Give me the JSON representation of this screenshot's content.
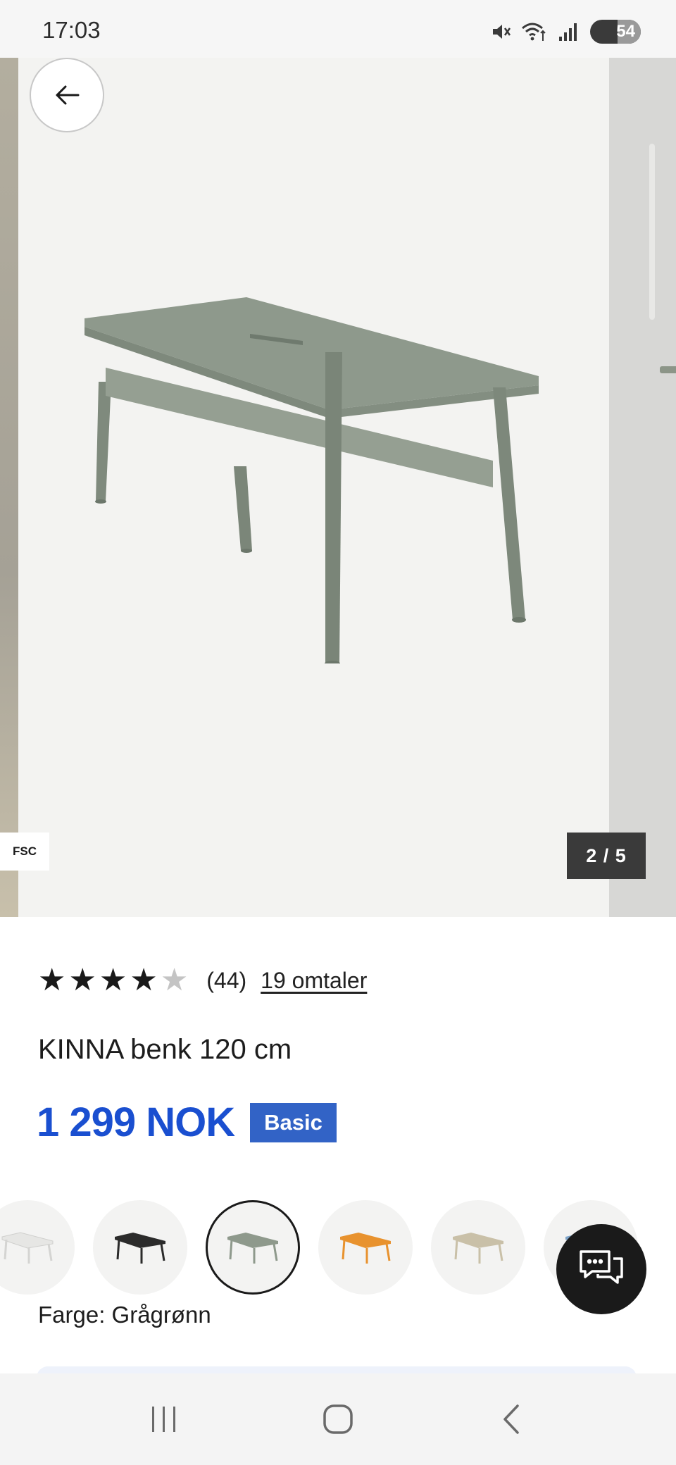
{
  "status_bar": {
    "time": "17:03",
    "battery": "54",
    "icons": [
      "mute-icon",
      "wifi-icon",
      "signal-icon",
      "battery-icon"
    ]
  },
  "gallery": {
    "counter": "2 / 5",
    "certification_tag": "FSC",
    "bench_color": "#8e998c",
    "back_icon": "arrow-left-icon"
  },
  "product": {
    "rating": 4,
    "rating_max": 5,
    "rating_count": "(44)",
    "reviews_link": "19 omtaler",
    "title": "KINNA benk 120 cm",
    "price": "1 299 NOK",
    "badge": "Basic",
    "color_label": "Farge: Grågrønn"
  },
  "swatches": [
    {
      "name": "white",
      "color": "#e6e6e4",
      "selected": false
    },
    {
      "name": "black",
      "color": "#2b2b2b",
      "selected": false
    },
    {
      "name": "grey-green",
      "color": "#8e998c",
      "selected": true
    },
    {
      "name": "orange",
      "color": "#e8922e",
      "selected": false
    },
    {
      "name": "beige",
      "color": "#c9c0a8",
      "selected": false
    },
    {
      "name": "blue",
      "color": "#7da3c8",
      "selected": false
    }
  ],
  "colors": {
    "price": "#1a4fd0",
    "badge": "#3263c6",
    "chat_fab": "#1a1a1a"
  },
  "nav": [
    "recent-apps-icon",
    "home-icon",
    "back-icon"
  ]
}
